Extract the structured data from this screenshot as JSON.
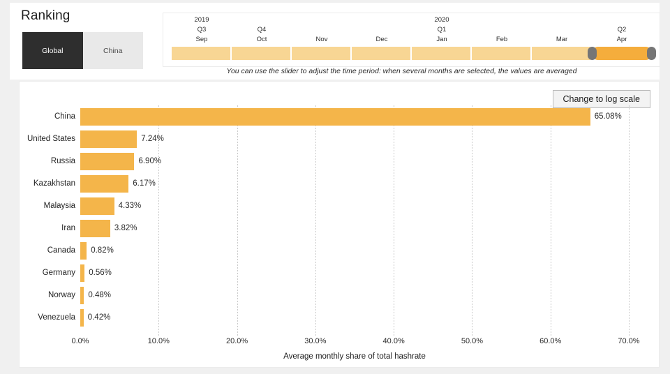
{
  "header": {
    "title": "Ranking"
  },
  "scope_toggle": {
    "options": [
      {
        "label": "Global",
        "selected": true
      },
      {
        "label": "China",
        "selected": false
      }
    ]
  },
  "timeline": {
    "caption": "You can use the slider to adjust the time period: when several months are selected, the values are averaged",
    "segments": [
      {
        "year": "2019",
        "quarter": "Q3",
        "month": "Sep",
        "selected": false
      },
      {
        "year": "",
        "quarter": "Q4",
        "month": "Oct",
        "selected": false
      },
      {
        "year": "",
        "quarter": "",
        "month": "Nov",
        "selected": false
      },
      {
        "year": "",
        "quarter": "",
        "month": "Dec",
        "selected": false
      },
      {
        "year": "2020",
        "quarter": "Q1",
        "month": "Jan",
        "selected": false
      },
      {
        "year": "",
        "quarter": "",
        "month": "Feb",
        "selected": false
      },
      {
        "year": "",
        "quarter": "",
        "month": "Mar",
        "selected": false
      },
      {
        "year": "",
        "quarter": "Q2",
        "month": "Apr",
        "selected": true
      }
    ]
  },
  "chart_toolbar": {
    "log_scale_label": "Change to log scale"
  },
  "colors": {
    "bar": "#f4b54a",
    "slider_inactive": "#f8d694",
    "slider_active": "#f5ad3c",
    "slider_handle": "#767676",
    "toggle_selected_bg": "#2e2e2e",
    "toggle_unselected_bg": "#e9e9e9",
    "page_bg": "#f0f0f0",
    "card_bg": "#ffffff"
  },
  "chart_data": {
    "type": "bar",
    "orientation": "horizontal",
    "title": "",
    "xlabel": "Average monthly share of total hashrate",
    "ylabel": "",
    "xlim": [
      0,
      70
    ],
    "x_ticks": [
      "0.0%",
      "10.0%",
      "20.0%",
      "30.0%",
      "40.0%",
      "50.0%",
      "60.0%",
      "70.0%"
    ],
    "x_tick_values": [
      0,
      10,
      20,
      30,
      40,
      50,
      60,
      70
    ],
    "grid": "vertical-dotted",
    "legend": "none",
    "categories": [
      "China",
      "United States",
      "Russia",
      "Kazakhstan",
      "Malaysia",
      "Iran",
      "Canada",
      "Germany",
      "Norway",
      "Venezuela"
    ],
    "values": [
      65.08,
      7.24,
      6.9,
      6.17,
      4.33,
      3.82,
      0.82,
      0.56,
      0.48,
      0.42
    ],
    "value_labels": [
      "65.08%",
      "7.24%",
      "6.90%",
      "6.17%",
      "4.33%",
      "3.82%",
      "0.82%",
      "0.56%",
      "0.48%",
      "0.42%"
    ]
  }
}
